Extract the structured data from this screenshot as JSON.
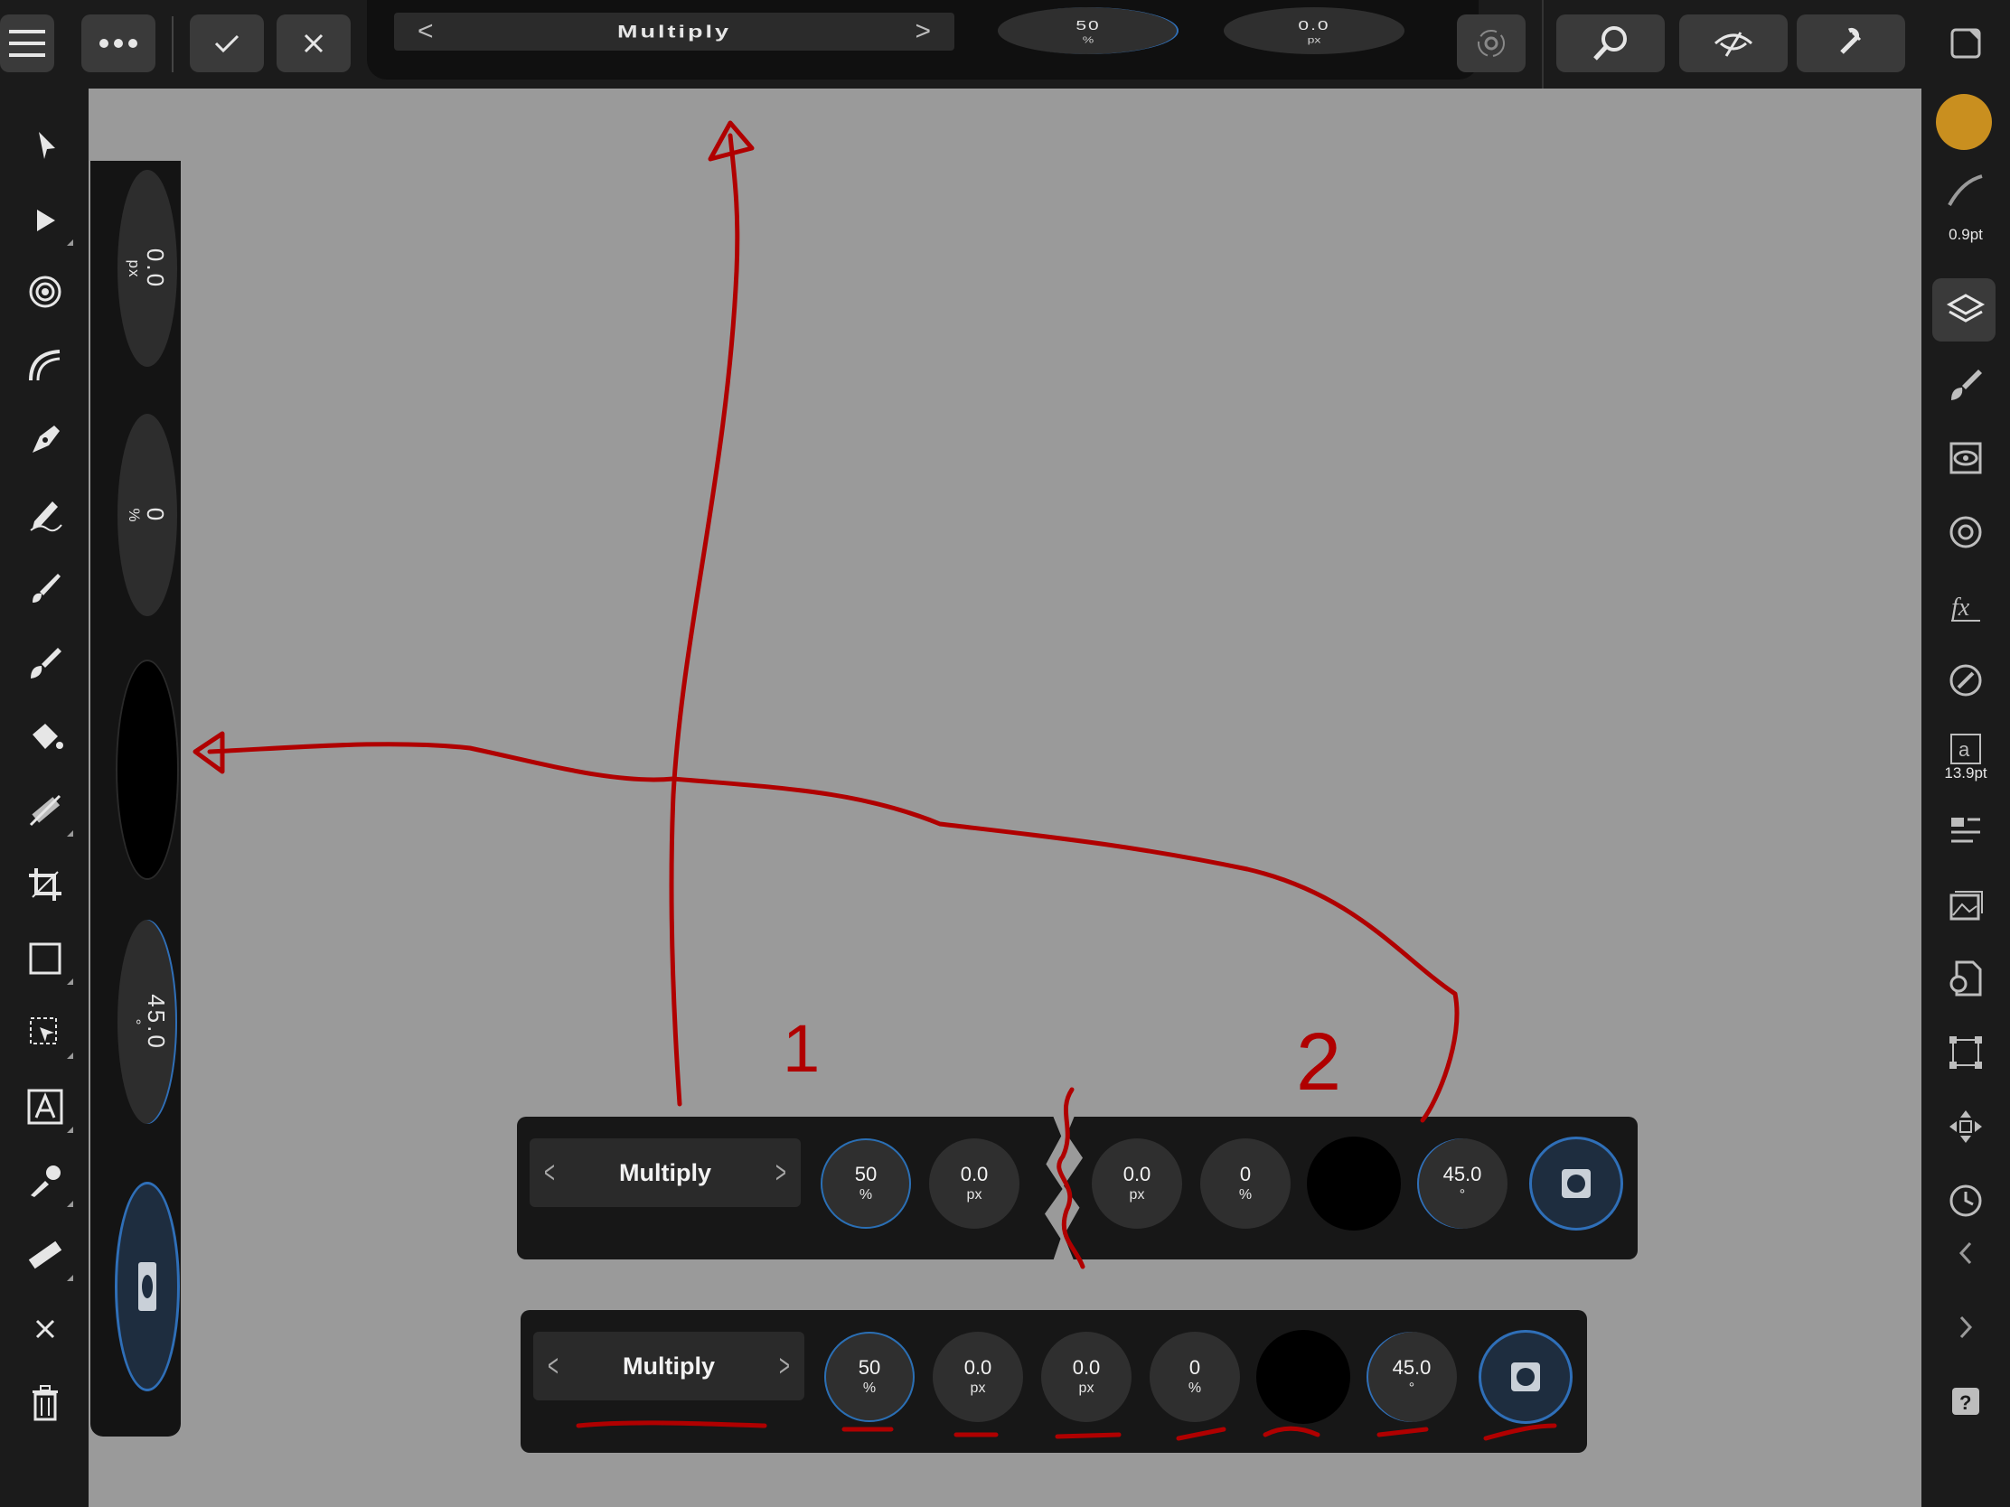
{
  "top_toolbar": {
    "blend_mode": "Multiply",
    "prev_arrow": "<",
    "next_arrow": ">",
    "opacity_value": "50",
    "opacity_unit": "%",
    "offset_value": "0.0",
    "offset_unit": "px"
  },
  "vertical_context_toolbar": {
    "dials": [
      {
        "value": "0.0",
        "unit": "px"
      },
      {
        "value": "0",
        "unit": "%"
      },
      {
        "value": "45.0",
        "unit": "°"
      }
    ]
  },
  "right_panel": {
    "brush_width": "0.9pt",
    "text_size": "13.9pt",
    "color_swatch": "#c98f1f"
  },
  "context_toolbar_split": {
    "blend_mode": "Multiply",
    "dials": [
      {
        "value": "50",
        "unit": "%"
      },
      {
        "value": "0.0",
        "unit": "px"
      },
      {
        "value": "0.0",
        "unit": "px"
      },
      {
        "value": "0",
        "unit": "%"
      },
      {
        "value": "45.0",
        "unit": "°"
      }
    ]
  },
  "context_toolbar_full": {
    "blend_mode": "Multiply",
    "dials": [
      {
        "value": "50",
        "unit": "%"
      },
      {
        "value": "0.0",
        "unit": "px"
      },
      {
        "value": "0.0",
        "unit": "px"
      },
      {
        "value": "0",
        "unit": "%"
      },
      {
        "value": "45.0",
        "unit": "°"
      }
    ]
  },
  "annotations": {
    "label_1": "1",
    "label_2": "2"
  },
  "colors": {
    "ink": "#b00000",
    "accent_ring": "#2f6fb8",
    "canvas": "#9a9a9a"
  }
}
